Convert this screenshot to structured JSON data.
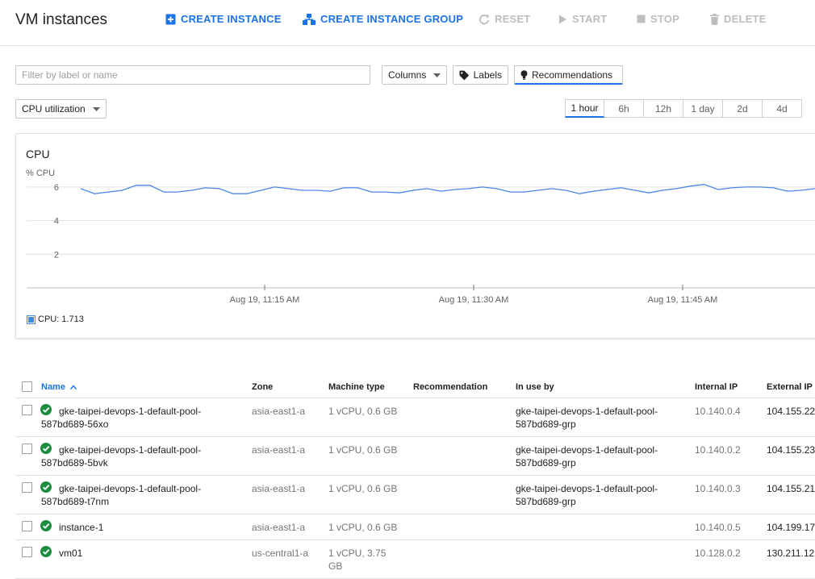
{
  "header": {
    "title": "VM instances",
    "actions": {
      "create_instance": "CREATE INSTANCE",
      "create_instance_group": "CREATE INSTANCE GROUP",
      "reset": "RESET",
      "start": "START",
      "stop": "STOP",
      "delete": "DELETE"
    }
  },
  "toolbar": {
    "filter_placeholder": "Filter by label or name",
    "columns_label": "Columns",
    "labels_label": "Labels",
    "recommendations_label": "Recommendations"
  },
  "metric_select": {
    "selected": "CPU utilization"
  },
  "time_ranges": [
    "1 hour",
    "6h",
    "12h",
    "1 day",
    "2d",
    "4d"
  ],
  "time_range_selected": "1 hour",
  "chart": {
    "title": "CPU",
    "y_axis_label": "% CPU",
    "legend_text": "CPU: 1.713"
  },
  "chart_data": {
    "type": "line",
    "title": "CPU",
    "ylabel": "% CPU",
    "y_ticks": [
      "6",
      "4",
      "2"
    ],
    "ylim": [
      0,
      7
    ],
    "grid": true,
    "x_ticks": [
      "Aug 19, 11:15 AM",
      "Aug 19, 11:30 AM",
      "Aug 19, 11:45 AM"
    ],
    "series": [
      {
        "name": "CPU",
        "color": "#4a86e8",
        "values": [
          5.9,
          5.6,
          5.7,
          5.8,
          6.1,
          6.1,
          5.7,
          5.7,
          5.8,
          5.95,
          5.9,
          5.6,
          5.6,
          5.8,
          6.0,
          5.9,
          5.8,
          5.8,
          5.75,
          5.95,
          5.95,
          5.7,
          5.7,
          5.65,
          5.8,
          5.9,
          5.75,
          5.85,
          5.9,
          6.0,
          5.9,
          5.7,
          5.7,
          5.8,
          5.9,
          5.8,
          5.6,
          5.75,
          5.85,
          5.95,
          5.8,
          5.65,
          5.8,
          5.9,
          6.05,
          6.15,
          5.85,
          5.95,
          6.0,
          6.0,
          5.95,
          5.75,
          5.8,
          5.9
        ]
      }
    ],
    "legend": "bottom-left"
  },
  "table": {
    "columns": {
      "name": "Name",
      "zone": "Zone",
      "machine_type": "Machine type",
      "recommendation": "Recommendation",
      "in_use_by": "In use by",
      "internal_ip": "Internal IP",
      "external_ip": "External IP"
    },
    "sort_column": "Name",
    "status_color": "#1e8e3e",
    "rows": [
      {
        "name_line1": "gke-taipei-devops-1-default-pool-",
        "name_line2": "587bd689-56xo",
        "zone": "asia-east1-a",
        "machine_line1": "1 vCPU, 0.6 GB",
        "machine_line2": "",
        "recommendation": "",
        "in_use_line1": "gke-taipei-devops-1-default-pool-",
        "in_use_line2": "587bd689-grp",
        "internal_ip": "10.140.0.4",
        "external_ip": "104.155.22"
      },
      {
        "name_line1": "gke-taipei-devops-1-default-pool-",
        "name_line2": "587bd689-5bvk",
        "zone": "asia-east1-a",
        "machine_line1": "1 vCPU, 0.6 GB",
        "machine_line2": "",
        "recommendation": "",
        "in_use_line1": "gke-taipei-devops-1-default-pool-",
        "in_use_line2": "587bd689-grp",
        "internal_ip": "10.140.0.2",
        "external_ip": "104.155.23"
      },
      {
        "name_line1": "gke-taipei-devops-1-default-pool-",
        "name_line2": "587bd689-t7nm",
        "zone": "asia-east1-a",
        "machine_line1": "1 vCPU, 0.6 GB",
        "machine_line2": "",
        "recommendation": "",
        "in_use_line1": "gke-taipei-devops-1-default-pool-",
        "in_use_line2": "587bd689-grp",
        "internal_ip": "10.140.0.3",
        "external_ip": "104.155.21"
      },
      {
        "name_line1": "instance-1",
        "name_line2": "",
        "zone": "asia-east1-a",
        "machine_line1": "1 vCPU, 0.6 GB",
        "machine_line2": "",
        "recommendation": "",
        "in_use_line1": "",
        "in_use_line2": "",
        "internal_ip": "10.140.0.5",
        "external_ip": "104.199.17"
      },
      {
        "name_line1": "vm01",
        "name_line2": "",
        "zone": "us-central1-a",
        "machine_line1": "1 vCPU, 3.75",
        "machine_line2": "GB",
        "recommendation": "",
        "in_use_line1": "",
        "in_use_line2": "",
        "internal_ip": "10.128.0.2",
        "external_ip": "130.211.12"
      }
    ]
  }
}
